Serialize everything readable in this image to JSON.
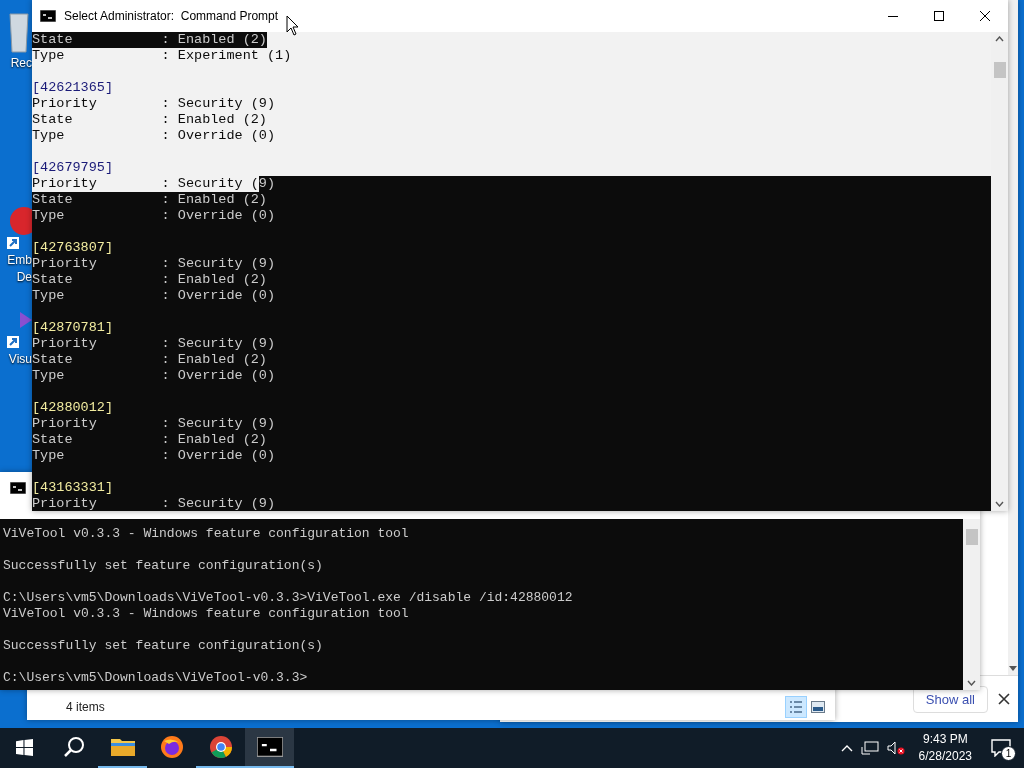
{
  "desktop": {
    "icons": [
      {
        "kind": "bin",
        "label_lines": [
          "Rec"
        ]
      },
      {
        "kind": "red",
        "label_lines": [
          "Emb",
          "De"
        ]
      },
      {
        "kind": "purple",
        "label_lines": [
          "Visu"
        ]
      }
    ]
  },
  "browser": {
    "download_bar": {
      "button": "Show all"
    }
  },
  "explorer": {
    "status": "4 items",
    "views": [
      {
        "kind": "details",
        "selected": true
      },
      {
        "kind": "preview",
        "selected": false
      }
    ]
  },
  "back_console": {
    "lines": [
      {
        "kind": "text",
        "text": "ViVeTool v0.3.3 - Windows feature configuration tool"
      },
      {
        "kind": "blank"
      },
      {
        "kind": "text",
        "text": "Successfully set feature configuration(s)"
      },
      {
        "kind": "blank"
      },
      {
        "kind": "text",
        "text": "C:\\Users\\vm5\\Downloads\\ViVeTool-v0.3.3>ViVeTool.exe /disable /id:42880012"
      },
      {
        "kind": "text",
        "text": "ViVeTool v0.3.3 - Windows feature configuration tool"
      },
      {
        "kind": "blank"
      },
      {
        "kind": "text",
        "text": "Successfully set feature configuration(s)"
      },
      {
        "kind": "blank"
      },
      {
        "kind": "text",
        "text": "C:\\Users\\vm5\\Downloads\\ViVeTool-v0.3.3>"
      }
    ]
  },
  "front_console": {
    "title": "Select Administrator:  Command Prompt",
    "lines": [
      {
        "kind": "field",
        "segments": [
          {
            "text": "State           : Enabled (2)",
            "selected": false
          }
        ],
        "tail_selected": true
      },
      {
        "kind": "field",
        "text": "Type            : Experiment (1)",
        "selected": true
      },
      {
        "kind": "blank",
        "selected": true
      },
      {
        "kind": "id",
        "text": "[42621365]",
        "selected": true
      },
      {
        "kind": "field",
        "text": "Priority        : Security (9)",
        "selected": true
      },
      {
        "kind": "field",
        "text": "State           : Enabled (2)",
        "selected": true
      },
      {
        "kind": "field",
        "text": "Type            : Override (0)",
        "selected": true
      },
      {
        "kind": "blank",
        "selected": true
      },
      {
        "kind": "id",
        "text": "[42679795]",
        "selected": true
      },
      {
        "kind": "field",
        "segments": [
          {
            "text": "Priority        : Security (",
            "selected": true
          },
          {
            "text": "9)",
            "selected": false
          }
        ],
        "tail_selected": false
      },
      {
        "kind": "field",
        "text": "State           : Enabled (2)",
        "selected": false
      },
      {
        "kind": "field",
        "text": "Type            : Override (0)",
        "selected": false
      },
      {
        "kind": "blank",
        "selected": false
      },
      {
        "kind": "id",
        "text": "[42763807]",
        "selected": false
      },
      {
        "kind": "field",
        "text": "Priority        : Security (9)",
        "selected": false
      },
      {
        "kind": "field",
        "text": "State           : Enabled (2)",
        "selected": false
      },
      {
        "kind": "field",
        "text": "Type            : Override (0)",
        "selected": false
      },
      {
        "kind": "blank",
        "selected": false
      },
      {
        "kind": "id",
        "text": "[42870781]",
        "selected": false
      },
      {
        "kind": "field",
        "text": "Priority        : Security (9)",
        "selected": false
      },
      {
        "kind": "field",
        "text": "State           : Enabled (2)",
        "selected": false
      },
      {
        "kind": "field",
        "text": "Type            : Override (0)",
        "selected": false
      },
      {
        "kind": "blank",
        "selected": false
      },
      {
        "kind": "id",
        "text": "[42880012]",
        "selected": false
      },
      {
        "kind": "field",
        "text": "Priority        : Security (9)",
        "selected": false
      },
      {
        "kind": "field",
        "text": "State           : Enabled (2)",
        "selected": false
      },
      {
        "kind": "field",
        "text": "Type            : Override (0)",
        "selected": false
      },
      {
        "kind": "blank",
        "selected": false
      },
      {
        "kind": "id",
        "text": "[43163331]",
        "selected": false
      },
      {
        "kind": "field",
        "text": "Priority        : Security (9)",
        "selected": false
      }
    ]
  },
  "taskbar": {
    "apps": [
      {
        "kind": "start",
        "running": false,
        "selected": false
      },
      {
        "kind": "search",
        "running": false,
        "selected": false
      },
      {
        "kind": "folder",
        "running": true,
        "selected": false
      },
      {
        "kind": "firefox",
        "running": false,
        "selected": false
      },
      {
        "kind": "chrome",
        "running": true,
        "selected": false
      },
      {
        "kind": "terminal",
        "running": true,
        "selected": true
      }
    ],
    "clock": {
      "time": "9:43 PM",
      "date": "6/28/2023"
    },
    "notifications": "1"
  }
}
